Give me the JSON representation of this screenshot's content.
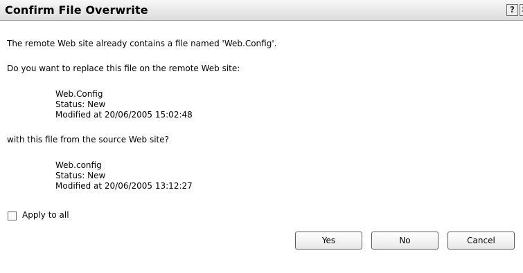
{
  "window": {
    "title": "Confirm File Overwrite",
    "help_label": "?",
    "close_label": "✕"
  },
  "message": {
    "line1": "The remote Web site already contains a file named 'Web.Config'.",
    "line2": "Do you want to replace this file on the remote Web site:",
    "line3": "with this file from the source Web site?"
  },
  "remote_file": {
    "name": "Web.Config",
    "status": "Status: New",
    "modified": "Modified at 20/06/2005 15:02:48"
  },
  "source_file": {
    "name": "Web.config",
    "status": "Status: New",
    "modified": "Modified at 20/06/2005 13:12:27"
  },
  "apply_all": {
    "label": "Apply to all",
    "checked": false
  },
  "buttons": {
    "yes": "Yes",
    "no": "No",
    "cancel": "Cancel"
  }
}
